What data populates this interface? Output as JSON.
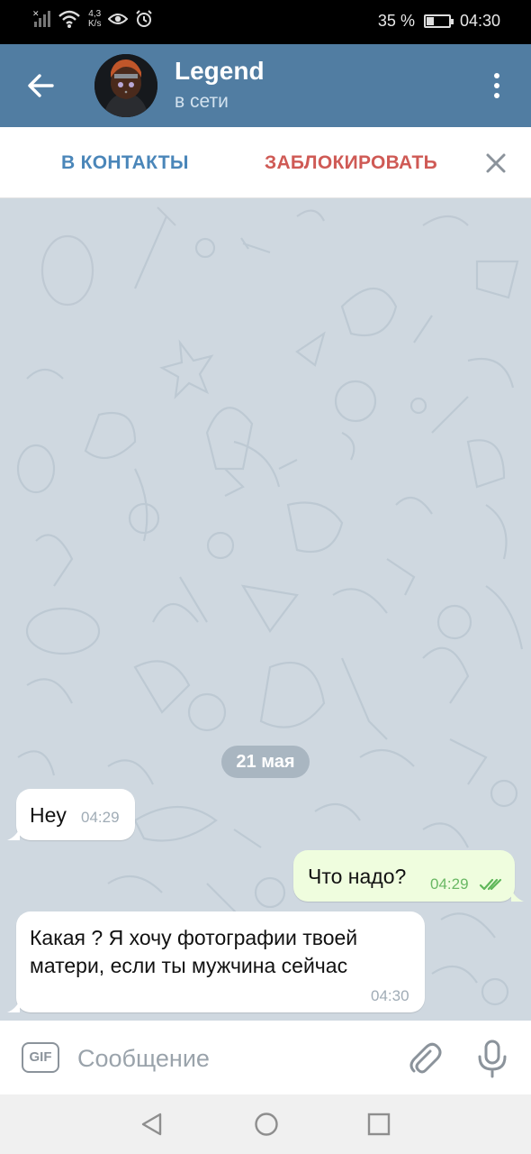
{
  "status_bar": {
    "net_speed_value": "4,3",
    "net_speed_unit": "K/s",
    "battery_percent": "35 %",
    "battery_level": 0.35,
    "time": "04:30",
    "icons": [
      "no-sim-signal-icon",
      "wifi-icon",
      "eye-icon",
      "alarm-icon",
      "battery-charging-icon"
    ]
  },
  "header": {
    "title": "Legend",
    "status": "в сети"
  },
  "actions": {
    "add_contact": "В КОНТАКТЫ",
    "block": "ЗАБЛОКИРОВАТЬ"
  },
  "chat": {
    "date_label": "21 мая",
    "messages": [
      {
        "direction": "in",
        "text": "Hey",
        "time": "04:29"
      },
      {
        "direction": "out",
        "text": "Что надо?",
        "time": "04:29",
        "read": true
      },
      {
        "direction": "in",
        "text": "Какая ?  Я хочу фотографии твоей матери, если ты мужчина сейчас",
        "time": "04:30"
      }
    ]
  },
  "composer": {
    "gif_label": "GIF",
    "placeholder": "Сообщение"
  },
  "colors": {
    "header": "#517da2",
    "chat_background": "#cfd8e0",
    "outgoing_bubble": "#effdde",
    "incoming_bubble": "#ffffff",
    "block_text": "#cf5a55",
    "contact_text": "#4a86b9"
  }
}
